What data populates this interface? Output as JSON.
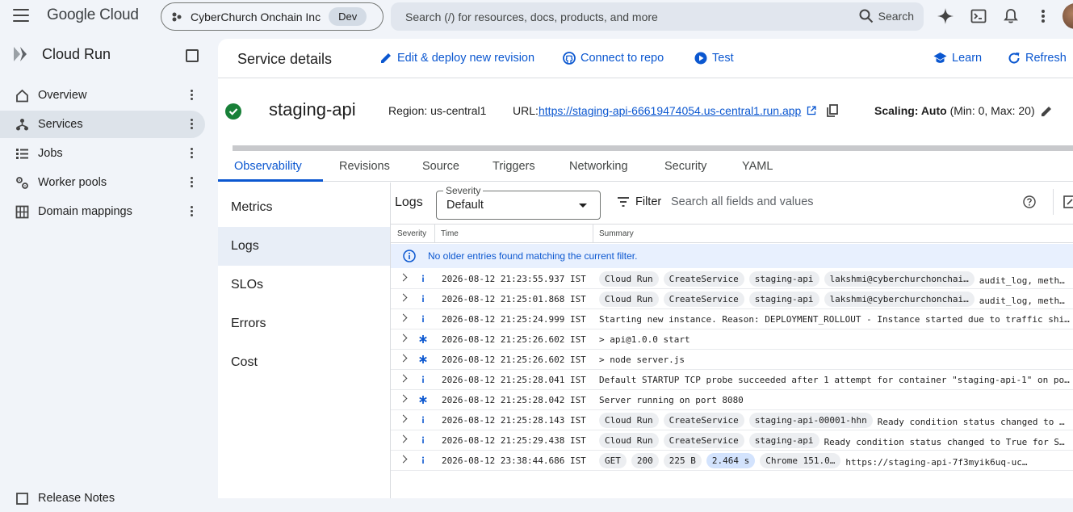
{
  "topbar": {
    "brand": "Google Cloud",
    "project_name": "CyberChurch Onchain Inc",
    "env_badge": "Dev",
    "search_placeholder": "Search (/) for resources, docs, products, and more",
    "search_button": "Search"
  },
  "sidebar": {
    "product_title": "Cloud Run",
    "items": [
      {
        "label": "Overview",
        "icon": "home-icon"
      },
      {
        "label": "Services",
        "icon": "services-icon",
        "active": true
      },
      {
        "label": "Jobs",
        "icon": "list-icon"
      },
      {
        "label": "Worker pools",
        "icon": "gears-icon"
      },
      {
        "label": "Domain mappings",
        "icon": "grid-icon"
      }
    ],
    "bottom_item": "Release Notes"
  },
  "header": {
    "title": "Service details",
    "actions": {
      "edit": "Edit & deploy new revision",
      "connect": "Connect to repo",
      "test": "Test",
      "learn": "Learn",
      "refresh": "Refresh"
    }
  },
  "service": {
    "name": "staging-api",
    "region": "Region: us-central1",
    "url_label": "URL:",
    "url": "https://staging-api-66619474054.us-central1.run.app",
    "scaling_label": "Scaling: Auto",
    "scaling_value": " (Min: 0, Max: 20)"
  },
  "tabs": [
    "Observability",
    "Revisions",
    "Source",
    "Triggers",
    "Networking",
    "Security",
    "YAML"
  ],
  "observability_nav": [
    "Metrics",
    "Logs",
    "SLOs",
    "Errors",
    "Cost"
  ],
  "logs": {
    "title": "Logs",
    "severity_label": "Severity",
    "severity_value": "Default",
    "filter_label": "Filter",
    "filter_placeholder": "Search all fields and values",
    "columns": [
      "Severity",
      "Time",
      "Summary"
    ],
    "banner": "No older entries found matching the current filter.",
    "rows": [
      {
        "sev": "info",
        "time": "2026-08-12 21:23:55.937 IST",
        "chips": [
          "Cloud Run",
          "CreateService",
          "staging-api",
          "lakshmi@cyberchurchonchai…"
        ],
        "text": "audit_log, meth…"
      },
      {
        "sev": "info",
        "time": "2026-08-12 21:25:01.868 IST",
        "chips": [
          "Cloud Run",
          "CreateService",
          "staging-api",
          "lakshmi@cyberchurchonchai…"
        ],
        "text": "audit_log, meth…"
      },
      {
        "sev": "info",
        "time": "2026-08-12 21:25:24.999 IST",
        "chips": [],
        "text": "Starting new instance. Reason: DEPLOYMENT_ROLLOUT - Instance started due to traffic shi…"
      },
      {
        "sev": "default",
        "time": "2026-08-12 21:25:26.602 IST",
        "chips": [],
        "text": "> api@1.0.0 start"
      },
      {
        "sev": "default",
        "time": "2026-08-12 21:25:26.602 IST",
        "chips": [],
        "text": "> node server.js"
      },
      {
        "sev": "info",
        "time": "2026-08-12 21:25:28.041 IST",
        "chips": [],
        "text": "Default STARTUP TCP probe succeeded after 1 attempt for container \"staging-api-1\" on po…"
      },
      {
        "sev": "default",
        "time": "2026-08-12 21:25:28.042 IST",
        "chips": [],
        "text": "Server running on port 8080"
      },
      {
        "sev": "info",
        "time": "2026-08-12 21:25:28.143 IST",
        "chips": [
          "Cloud Run",
          "CreateService",
          "staging-api-00001-hhn"
        ],
        "text": "Ready condition status changed to …"
      },
      {
        "sev": "info",
        "time": "2026-08-12 21:25:29.438 IST",
        "chips": [
          "Cloud Run",
          "CreateService",
          "staging-api"
        ],
        "text": "Ready condition status changed to True for S…"
      },
      {
        "sev": "info",
        "time": "2026-08-12 23:38:44.686 IST",
        "chips": [
          "GET",
          "200",
          "225 B",
          "2.464 s",
          "Chrome 151.0…"
        ],
        "text": "https://staging-api-7f3myik6uq-uc…"
      }
    ]
  }
}
